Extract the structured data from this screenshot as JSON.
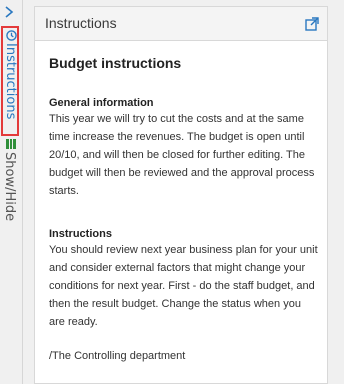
{
  "rail": {
    "expand_icon": "chevron-right-icon",
    "instructions_label": "Instructions",
    "instructions_icon": "clock-icon",
    "show_hide_label": "Show/Hide",
    "show_hide_icon": "bars-icon"
  },
  "panel": {
    "title": "Instructions",
    "popout_icon": "external-link-icon",
    "heading": "Budget instructions",
    "sections": [
      {
        "title": "General information",
        "text": "This year we will try to cut the costs and at the same time increase the revenues. The budget is open until 20/10, and will then be closed for further editing. The budget will then be reviewed and the approval process starts."
      },
      {
        "title": "Instructions",
        "text": "You should review next year business plan for your unit and consider external factors that might change your conditions for next year. First - do the staff budget, and then the result budget. Change the status when you are ready."
      }
    ],
    "signature": "/The Controlling department"
  },
  "colors": {
    "accent": "#2a78c0",
    "highlight_border": "#e33a3a"
  }
}
